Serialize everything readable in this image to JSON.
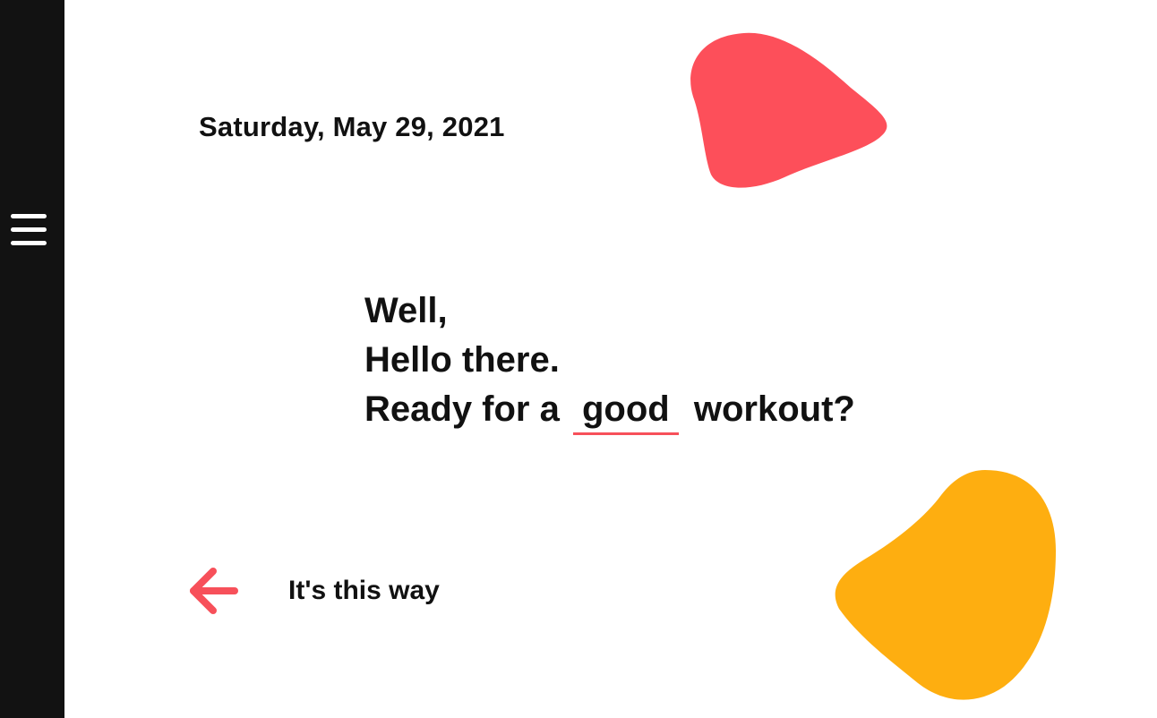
{
  "sidebar": {
    "menu_icon": "hamburger-menu-icon",
    "background_color": "#121212"
  },
  "header": {
    "date": "Saturday, May 29, 2021"
  },
  "greeting": {
    "line1": "Well,",
    "line2": "Hello there.",
    "line3_prefix": "Ready for a",
    "line3_highlight": "good",
    "line3_suffix": "workout?",
    "highlight_underline_color": "#f7505a"
  },
  "navigation_hint": {
    "icon": "arrow-left-icon",
    "label": "It's this way",
    "icon_color": "#f7505a"
  },
  "decorations": {
    "red_blob_color": "#fd4f5a",
    "yellow_blob_color": "#feae10"
  }
}
